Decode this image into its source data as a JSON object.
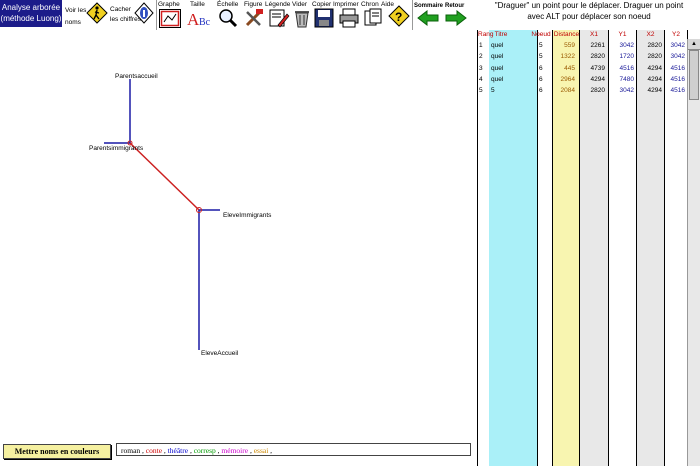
{
  "toolbar": {
    "app_title_line1": "Analyse arborée",
    "app_title_line2": "(méthode Luong)",
    "voir_line1": "Voir les",
    "voir_line2": "noms",
    "cacher_line1": "Cacher",
    "cacher_line2": "les chiffres",
    "graphe": "Graphe",
    "taille": "Taille",
    "echelle": "Échelle",
    "figure": "Figure",
    "legende": "Légende",
    "vider": "Vider",
    "copier": "Copier",
    "imprimer": "Imprimer",
    "chron": "Chron",
    "aide": "Aide",
    "sommaire": "Sommaire",
    "retour": "Retour"
  },
  "instructions": {
    "line1": "\"Draguer\" un point pour le déplacer. Draguer un point",
    "line2": "avec ALT pour déplacer son noeud"
  },
  "table": {
    "headers": {
      "rang": "Rang",
      "titre": "Titre",
      "noeud": "Noeud",
      "distance": "Distance",
      "x1": "X1",
      "y1": "Y1",
      "x2": "X2",
      "y2": "Y2"
    },
    "rows": [
      {
        "rang": "1",
        "titre": "quel",
        "noeud": "5",
        "distance": "559",
        "x1": "2261",
        "y1": "3042",
        "x2": "2820",
        "y2": "3042"
      },
      {
        "rang": "2",
        "titre": "quel",
        "noeud": "5",
        "distance": "1322",
        "x1": "2820",
        "y1": "1720",
        "x2": "2820",
        "y2": "3042"
      },
      {
        "rang": "3",
        "titre": "quel",
        "noeud": "6",
        "distance": "445",
        "x1": "4739",
        "y1": "4516",
        "x2": "4294",
        "y2": "4516"
      },
      {
        "rang": "4",
        "titre": "quel",
        "noeud": "6",
        "distance": "2964",
        "x1": "4294",
        "y1": "7480",
        "x2": "4294",
        "y2": "4516"
      },
      {
        "rang": "5",
        "titre": "5",
        "noeud": "6",
        "distance": "2084",
        "x1": "2820",
        "y1": "3042",
        "x2": "4294",
        "y2": "4516"
      }
    ]
  },
  "tree": {
    "labels": {
      "parents_accueil": "Parentsaccueil",
      "parents_immigrants": "Parentsimmigrants",
      "eleve_immigrants": "EleveImmigrants",
      "eleve_accueil": "EleveAccueil"
    }
  },
  "bottom": {
    "color_button": "Mettre noms en couleurs",
    "legend_items": [
      {
        "text": "roman",
        "color": "#000000"
      },
      {
        "text": "conte",
        "color": "#cc0000"
      },
      {
        "text": "théâtre",
        "color": "#0000cc"
      },
      {
        "text": "corresp",
        "color": "#009900"
      },
      {
        "text": "mémoire",
        "color": "#cc00cc"
      },
      {
        "text": "essai",
        "color": "#cc8800"
      }
    ]
  },
  "colors": {
    "title_bg": "#1c1c8a",
    "branch_blue": "#1a1aa6",
    "branch_red": "#cc2020",
    "titre_col": "#aaf0f8",
    "distance_col": "#f8f5b0",
    "x_col": "#e8e8e8",
    "header_red": "#c00000",
    "y_text": "#1a1a99"
  }
}
